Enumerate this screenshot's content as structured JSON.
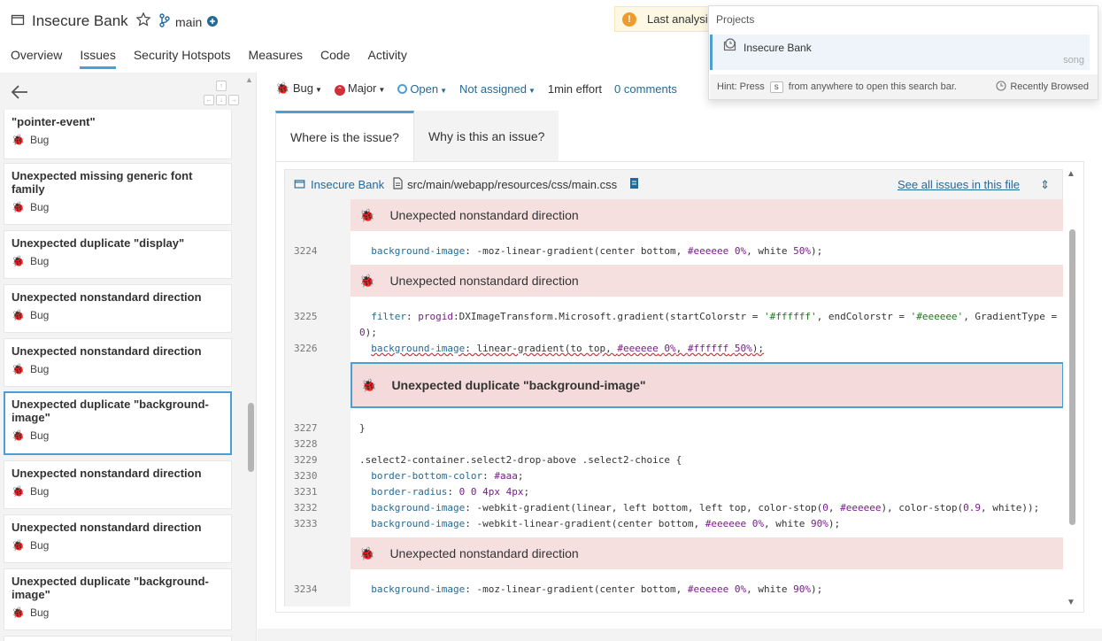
{
  "header": {
    "project_name": "Insecure Bank",
    "branch_name": "main",
    "warning_text": "Last analysis"
  },
  "nav": {
    "tabs": [
      "Overview",
      "Issues",
      "Security Hotspots",
      "Measures",
      "Code",
      "Activity"
    ],
    "active": "Issues"
  },
  "sidebar": {
    "keyboard_keys": [
      "↑",
      "←",
      "↓",
      "→"
    ],
    "issues": [
      {
        "title": "\"pointer-event\"",
        "type": "Bug"
      },
      {
        "title": "Unexpected missing generic font family",
        "type": "Bug"
      },
      {
        "title": "Unexpected duplicate \"display\"",
        "type": "Bug"
      },
      {
        "title": "Unexpected nonstandard direction",
        "type": "Bug"
      },
      {
        "title": "Unexpected nonstandard direction",
        "type": "Bug"
      },
      {
        "title": "Unexpected duplicate \"background-image\"",
        "type": "Bug"
      },
      {
        "title": "Unexpected nonstandard direction",
        "type": "Bug"
      },
      {
        "title": "Unexpected nonstandard direction",
        "type": "Bug"
      },
      {
        "title": "Unexpected duplicate \"background-image\"",
        "type": "Bug"
      }
    ]
  },
  "issue_meta": {
    "type": "Bug",
    "severity": "Major",
    "status": "Open",
    "assignee": "Not assigned",
    "effort": "1min effort",
    "comments": "0 comments"
  },
  "issue_tabs": [
    "Where is the issue?",
    "Why is this an issue?"
  ],
  "code_header": {
    "project": "Insecure Bank",
    "file_path": "src/main/webapp/resources/css/main.css",
    "see_all": "See all issues in this file"
  },
  "code": {
    "locations": [
      "Unexpected nonstandard direction",
      "Unexpected nonstandard direction",
      "Unexpected duplicate \"background-image\"",
      "Unexpected nonstandard direction"
    ],
    "line_numbers": [
      "3224",
      "3225",
      "3226",
      "3227",
      "3228",
      "3229",
      "3230",
      "3231",
      "3232",
      "3233",
      "3234"
    ]
  },
  "search_dropdown": {
    "heading": "Projects",
    "item_name": "Insecure Bank",
    "item_qualifier": "song",
    "hint_prefix": "Hint: Press",
    "hint_key": "s",
    "hint_suffix": "from anywhere to open this search bar.",
    "recent_label": "Recently Browsed"
  }
}
